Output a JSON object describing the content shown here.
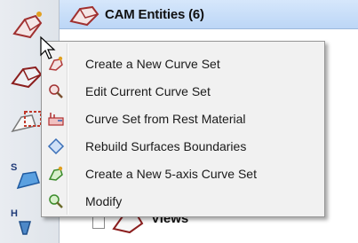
{
  "header": {
    "title": "CAM Entities (6)"
  },
  "tree": {
    "views_label": "Views"
  },
  "context_menu": {
    "items": [
      {
        "label": "Create a New Curve Set",
        "icon": "curve-set-new-icon"
      },
      {
        "label": "Edit Current Curve Set",
        "icon": "curve-set-edit-icon"
      },
      {
        "label": "Curve Set from Rest Material",
        "icon": "rest-material-icon"
      },
      {
        "label": "Rebuild Surfaces Boundaries",
        "icon": "rebuild-boundaries-icon"
      },
      {
        "label": "Create a New 5-axis Curve Set",
        "icon": "five-axis-curve-set-icon"
      },
      {
        "label": "Modify",
        "icon": "modify-icon"
      }
    ]
  },
  "toolbar": {
    "tools": [
      {
        "icon": "cam-entity-tool-icon",
        "letter": ""
      },
      {
        "icon": "surface-tool-icon",
        "letter": ""
      },
      {
        "icon": "curve-tool-icon",
        "letter": ""
      },
      {
        "icon": "setup-tool-icon",
        "letter": "S"
      },
      {
        "icon": "home-tool-icon",
        "letter": "H"
      }
    ]
  },
  "colors": {
    "header_bg": "#bcd6f6",
    "menu_bg": "#f1f1f1",
    "accent_red": "#c0392b"
  }
}
